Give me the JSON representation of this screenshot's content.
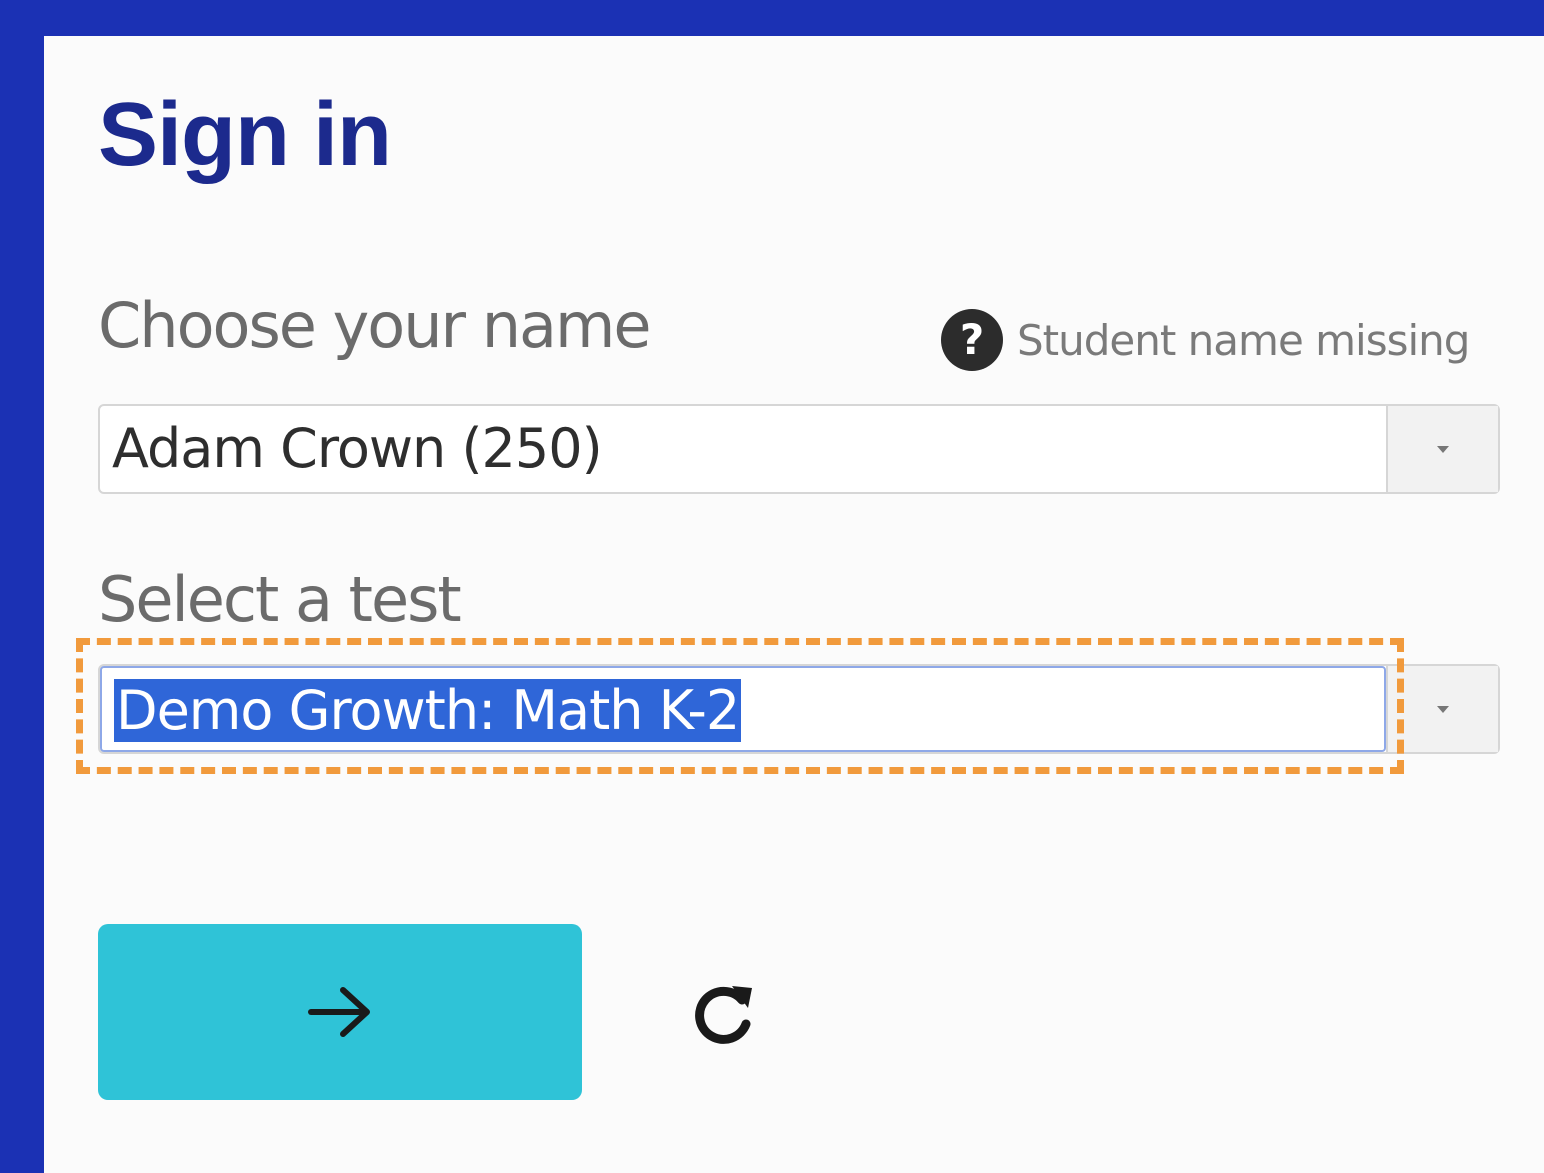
{
  "header": {
    "title": "Sign in"
  },
  "name_field": {
    "label": "Choose your name",
    "help_icon": "question-circle-icon",
    "help_text": "Student name missing",
    "value": "Adam Crown (250)",
    "toggle_icon": "caret-down-icon"
  },
  "test_field": {
    "label": "Select a test",
    "value": "Demo Growth: Math K-2",
    "toggle_icon": "caret-down-icon",
    "text_selected": true,
    "focused": true
  },
  "actions": {
    "next_icon": "arrow-right-icon",
    "refresh_icon": "refresh-icon"
  },
  "colors": {
    "background": "#1b31b4",
    "title": "#1c2a8d",
    "next_button": "#2fc3d7",
    "focus_outline": "#f19a3c",
    "selection": "#2f66d8"
  }
}
